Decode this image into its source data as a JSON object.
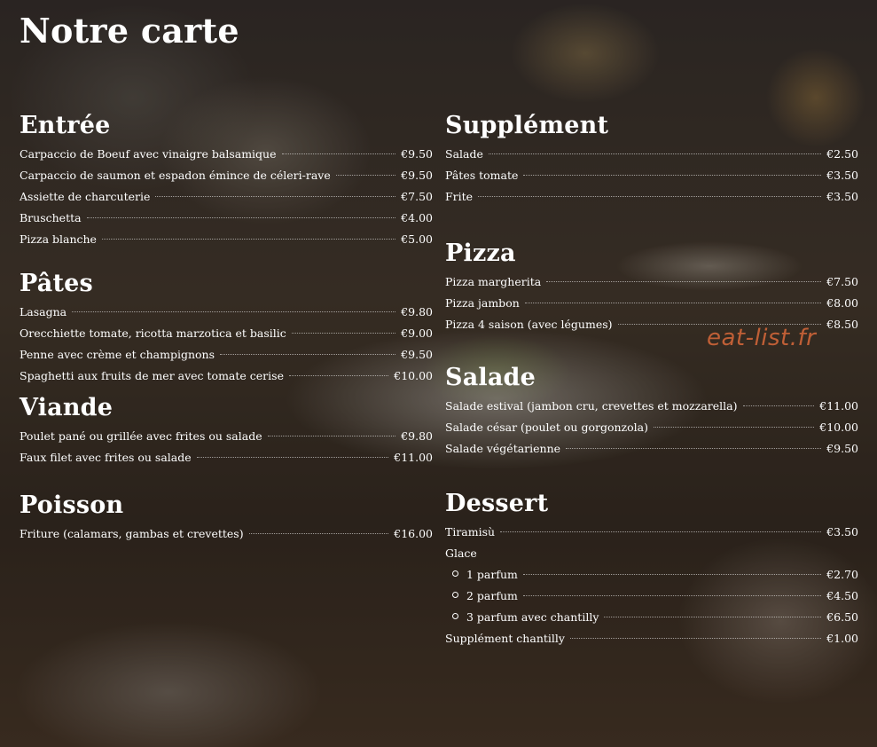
{
  "page": {
    "title": "Notre carte"
  },
  "watermark": "eat-list.fr",
  "left_column": [
    {
      "title": "Entrée",
      "items": [
        {
          "name": "Carpaccio de Boeuf avec vinaigre balsamique",
          "price": "€9.50"
        },
        {
          "name": "Carpaccio de saumon et espadon émince de céleri-rave",
          "price": "€9.50"
        },
        {
          "name": "Assiette de charcuterie",
          "price": "€7.50"
        },
        {
          "name": "Bruschetta",
          "price": "€4.00"
        },
        {
          "name": "Pizza blanche",
          "price": "€5.00"
        }
      ]
    },
    {
      "title": "Pâtes",
      "items": [
        {
          "name": "Lasagna",
          "price": "€9.80"
        },
        {
          "name": "Orecchiette tomate, ricotta marzotica et basilic",
          "price": "€9.00"
        },
        {
          "name": "Penne avec crème et champignons",
          "price": "€9.50"
        },
        {
          "name": "Spaghetti aux fruits de mer avec tomate cerise",
          "price": "€10.00"
        }
      ]
    },
    {
      "title": "Viande",
      "items": [
        {
          "name": "Poulet pané ou grillée avec frites ou salade",
          "price": "€9.80"
        },
        {
          "name": "Faux filet avec frites ou salade",
          "price": "€11.00"
        }
      ]
    },
    {
      "title": "Poisson",
      "items": [
        {
          "name": "Friture (calamars, gambas et crevettes)",
          "price": "€16.00"
        }
      ]
    }
  ],
  "right_column": [
    {
      "title": "Supplément",
      "items": [
        {
          "name": "Salade",
          "price": "€2.50"
        },
        {
          "name": "Pâtes tomate",
          "price": "€3.50"
        },
        {
          "name": "Frite",
          "price": "€3.50"
        }
      ]
    },
    {
      "title": "Pizza",
      "items": [
        {
          "name": "Pizza margherita",
          "price": "€7.50"
        },
        {
          "name": "Pizza jambon",
          "price": "€8.00"
        },
        {
          "name": "Pizza 4 saison (avec légumes)",
          "price": "€8.50"
        }
      ]
    },
    {
      "title": "Salade",
      "items": [
        {
          "name": "Salade estival (jambon cru, crevettes et mozzarella)",
          "price": "€11.00"
        },
        {
          "name": "Salade césar (poulet ou gorgonzola)",
          "price": "€10.00"
        },
        {
          "name": "Salade végétarienne",
          "price": "€9.50"
        }
      ]
    },
    {
      "title": "Dessert",
      "items": [
        {
          "name": "Tiramisù",
          "price": "€3.50"
        }
      ],
      "group": {
        "label": "Glace",
        "items": [
          {
            "name": "1 parfum",
            "price": "€2.70"
          },
          {
            "name": "2 parfum",
            "price": "€4.50"
          },
          {
            "name": "3 parfum avec chantilly",
            "price": "€6.50"
          }
        ]
      },
      "after": [
        {
          "name": "Supplément chantilly",
          "price": "€1.00"
        }
      ]
    }
  ]
}
